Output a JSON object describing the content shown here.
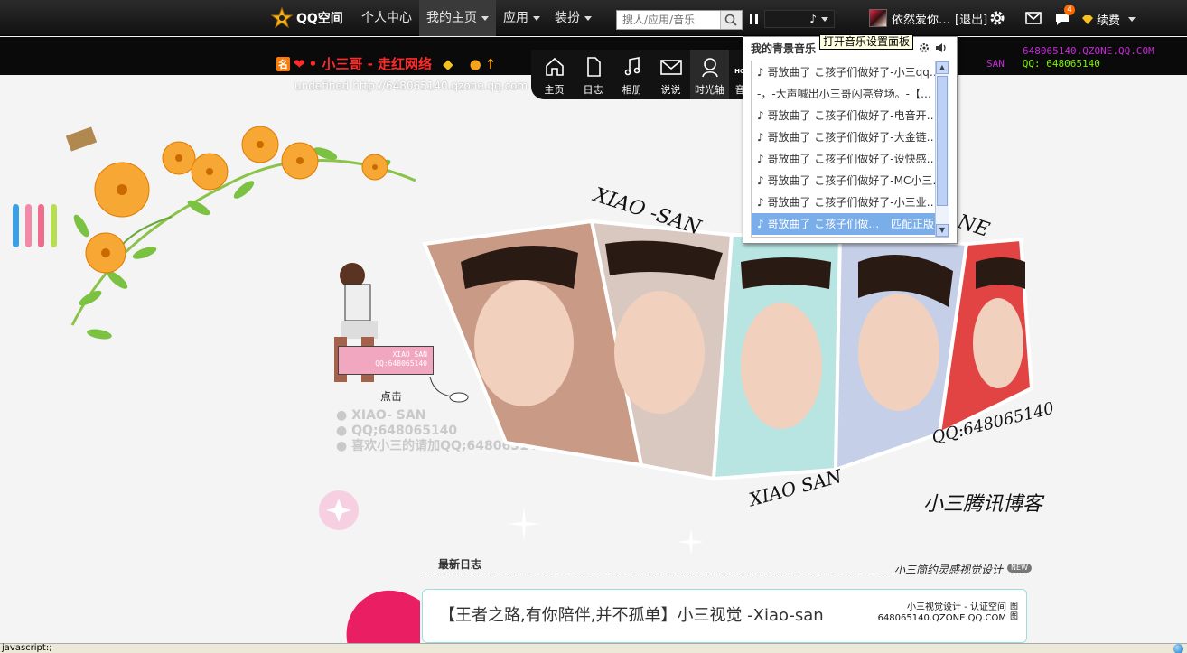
{
  "topbar": {
    "logo_text": "QQ空间",
    "nav": [
      {
        "label": "个人中心",
        "caret": false
      },
      {
        "label": "我的主页",
        "caret": true
      },
      {
        "label": "应用",
        "caret": true
      },
      {
        "label": "装扮",
        "caret": true
      }
    ],
    "search_placeholder": "搜人/应用/音乐",
    "player_note": "♪",
    "user_name": "依然爱你…",
    "logout": "[退出]",
    "notify_count": "4",
    "renew": "续费"
  },
  "strip": {
    "title_badge": "名",
    "title": "• 小三哥 - 走红网络",
    "url": "undefined   http://648065140.qzone.qq.com",
    "right_line1": "648065140.QZONE.QQ.COM",
    "right_line2_a": "SAN",
    "right_line2_b": "QQ: 648065140"
  },
  "sections": [
    {
      "label": "主页",
      "icon": "home-icon"
    },
    {
      "label": "日志",
      "icon": "document-icon"
    },
    {
      "label": "相册",
      "icon": "music-note-icon"
    },
    {
      "label": "说说",
      "icon": "mail-icon"
    },
    {
      "label": "时光轴",
      "icon": "person-icon"
    },
    {
      "label": "音",
      "icon": "home-sign-icon"
    }
  ],
  "music": {
    "title": "我的青景音乐",
    "tooltip": "打开音乐设置面板",
    "tracks": [
      "♪ 哥放曲了 こ孩子们做好了-小三qq…",
      "-，-大声喊出小三哥闪亮登场。-【…",
      "♪ 哥放曲了 こ孩子们做好了-电音开…",
      "♪ 哥放曲了 こ孩子们做好了-大金链…",
      "♪ 哥放曲了 こ孩子们做好了-设快感…",
      "♪ 哥放曲了 こ孩子们做好了-MC小三…",
      "♪ 哥放曲了 こ孩子们做好了-小三业…",
      "♪ 哥放曲了 こ孩子们做…"
    ],
    "selected_match": "匹配正版"
  },
  "banner": {
    "card_line1": "XIAO SAN",
    "card_line2": "QQ:648065140",
    "click": "点击",
    "info": [
      "XIAO- SAN",
      "QQ;648065140",
      "喜欢小三的请加QQ;648065140"
    ],
    "script1": "XIAO -SAN",
    "script2": "XIAO SAN",
    "script3": "QQ:648065140",
    "script4": "NE",
    "signature": "小三腾讯博客"
  },
  "blog": {
    "head": "最新日志",
    "head_right": "小三简约灵感视觉设计",
    "new_tag": "NEW",
    "title": "【王者之路,有你陪伴,并不孤单】小三视觉 -Xiao-san",
    "stamp_line1": "小三视觉设计 - 认证空间",
    "stamp_line2": "648065140.QZONE.QQ.COM",
    "stamp_side": "图图"
  },
  "status": {
    "text": "javascript:;"
  },
  "colors": {
    "accent": "#ff2a2a",
    "selected": "#7aaeea",
    "bar1": "#3aa0e6",
    "bar2": "#f08aa8",
    "bar3": "#f06c8c",
    "bar4": "#b7dd55"
  }
}
